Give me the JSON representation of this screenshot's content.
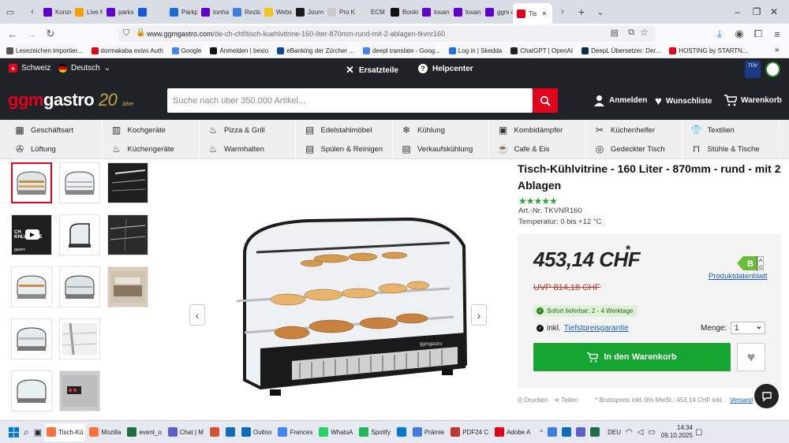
{
  "browser": {
    "tabs": [
      {
        "label": "Konze",
        "color": "#6001d2"
      },
      {
        "label": "Live M",
        "color": "#f6a000"
      },
      {
        "label": "parksc",
        "color": "#6001d2"
      },
      {
        "label": "",
        "color": "#1a56db"
      },
      {
        "label": "Parkpl",
        "color": "#1c6dd0"
      },
      {
        "label": "tonhal",
        "color": "#6001d2"
      },
      {
        "label": "Rezita",
        "color": "#3f7de0"
      },
      {
        "label": "Webst",
        "color": "#f5c518"
      },
      {
        "label": "Journa",
        "color": "#1b1b1b"
      },
      {
        "label": "Pro Ka",
        "color": "#cccccc"
      },
      {
        "label": "ECM -",
        "color": "#dddddd"
      },
      {
        "label": "Bookin",
        "color": "#111111"
      },
      {
        "label": "louan",
        "color": "#6001d2"
      },
      {
        "label": "louan",
        "color": "#6001d2"
      },
      {
        "label": "ggm c",
        "color": "#6001d2"
      },
      {
        "label": "Tis",
        "color": "#e2001a"
      }
    ],
    "url_host": "www.ggmgastro.com",
    "url_path": "/de-ch-chf/tisch-kuehlvitrine-160-liter-870mm-rund-mit-2-ablagen-tkvnr160",
    "bookmarks": [
      {
        "label": "Lesezeichen importier...",
        "color": "#555555"
      },
      {
        "label": "dormakaba exivo Auth",
        "color": "#e2001a"
      },
      {
        "label": "Google",
        "color": "#4285f4"
      },
      {
        "label": "Anmelden | bexio",
        "color": "#111111"
      },
      {
        "label": "eBanking der Zürcher ...",
        "color": "#0a4a9c"
      },
      {
        "label": "deepl translate - Goog...",
        "color": "#4285f4"
      },
      {
        "label": "Log in | Skedda",
        "color": "#1a73e8"
      },
      {
        "label": "ChatGPT | OpenAI",
        "color": "#222222"
      },
      {
        "label": "DeepL Übersetzer: Der...",
        "color": "#0f2b46"
      },
      {
        "label": "HOSTING by STARTN...",
        "color": "#e2001a"
      }
    ]
  },
  "topbar": {
    "country": "Schweiz",
    "language": "Deutsch",
    "spare_parts": "Ersatzteile",
    "help": "Helpcenter"
  },
  "header": {
    "logo_a": "ggm",
    "logo_b": "gastro",
    "logo_c": "20",
    "logo_d": "Jahre",
    "search_placeholder": "Suche nach über 350.000 Artikel...",
    "login": "Anmelden",
    "wishlist": "Wunschliste",
    "cart": "Warenkorb"
  },
  "categories": [
    "Geschäftsart",
    "Kochgeräte",
    "Pizza & Grill",
    "Edelstahlmöbel",
    "Kühlung",
    "Kombidämpfer",
    "Küchenhelfer",
    "Textilien",
    "Lüftung",
    "Küchengeräte",
    "Warmhalten",
    "Spülen & Reinigen",
    "Verkaufskühlung",
    "Cafe & Eis",
    "Gedeckter Tisch",
    "Stühle & Tische"
  ],
  "product": {
    "title": "Tisch-Kühlvitrine - 160 Liter - 870mm - rund - mit 2 Ablagen",
    "rating": 5,
    "art_nr": "Art.-Nr. TKVNR160",
    "temperature": "Temperatur: 0 bis +12 °C",
    "price": "453,14 CHF",
    "price_mark": "*",
    "uvp": "UVP 814,18 CHF",
    "energy_class": "B",
    "energy_range_top": "A",
    "energy_range_bottom": "G",
    "datasheet": "Produktdatenblatt",
    "availability": "Sofort lieferbar: 2 - 4 Werktage",
    "guarantee_prefix": "inkl.",
    "guarantee_link": "Tiefstpreisgarantie",
    "qty_label": "Menge:",
    "qty_value": "1",
    "add_to_cart": "In den Warenkorb",
    "print": "Drucken",
    "share": "Teilen",
    "tax_note": "* Bruttopreis inkl. 0% MwSt.: 453,14 CHF inkl.",
    "shipping_link": "Versand"
  },
  "gallery_video_label_a": "CH",
  "gallery_video_label_b": "KHLVITRINE",
  "gallery_video_brand": "gastro",
  "main_image_brand": "ggmgastro",
  "taskbar": {
    "items": [
      {
        "label": "Tisch-Kü",
        "color": "#ff7139",
        "active": true
      },
      {
        "label": "Mozilla",
        "color": "#ff7139",
        "active": false
      },
      {
        "label": "event_o",
        "color": "#1d6f42",
        "active": false
      },
      {
        "label": "Chat | M",
        "color": "#5b5fc7",
        "active": false
      },
      {
        "label": "",
        "color": "#d35230",
        "active": false
      },
      {
        "label": "",
        "color": "#0f6cbd",
        "active": false
      },
      {
        "label": "Outloo",
        "color": "#0f6cbd",
        "active": false
      },
      {
        "label": "Frances",
        "color": "#4285f4",
        "active": false
      },
      {
        "label": "WhatsA",
        "color": "#25d366",
        "active": false
      },
      {
        "label": "Spotify",
        "color": "#1db954",
        "active": false
      },
      {
        "label": "",
        "color": "#0078d4",
        "active": false
      },
      {
        "label": "Prämie",
        "color": "#3f7de0",
        "active": false
      },
      {
        "label": "PDF24 C",
        "color": "#c0392b",
        "active": false
      },
      {
        "label": "Adobe A",
        "color": "#e2001a",
        "active": false
      }
    ],
    "lang": "DEU",
    "time": "14:34",
    "date": "09.10.2025"
  }
}
